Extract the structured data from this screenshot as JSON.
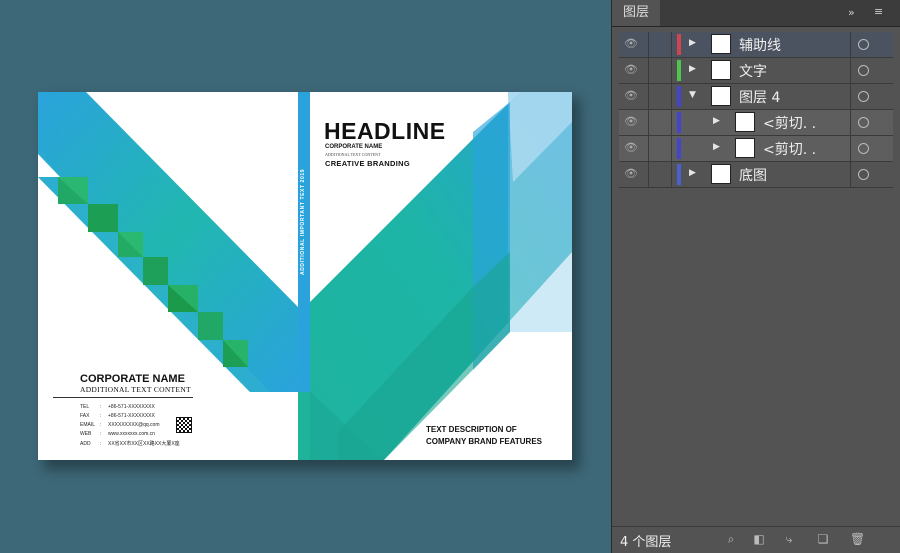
{
  "cover": {
    "headline": "HEADLINE",
    "corporate_name_small": "CORPORATE NAME",
    "additional_text_small": "ADDITIONAL TEXT CONTENT",
    "creative_branding": "CREATIVE BRANDING",
    "corporate_name": "CORPORATE NAME",
    "additional_text": "ADDITIONAL TEXT CONTENT",
    "contacts": [
      {
        "label": "TEL",
        "sep": ":",
        "value": "+86-571-XXXXXXXX"
      },
      {
        "label": "FAX",
        "sep": ":",
        "value": "+86-571-XXXXXXXX"
      },
      {
        "label": "EMAIL",
        "sep": ":",
        "value": "XXXXXXXXX@qq.com"
      },
      {
        "label": "WEB",
        "sep": ":",
        "value": "www.xxxxxxx.com.cn"
      },
      {
        "label": "ADD",
        "sep": ":",
        "value": "XX省XX市XX区XX路XX大厦X座"
      }
    ],
    "spine_text": "ADDITIONAL IMPORTANT TEXT 2019",
    "description_line1": "TEXT DESCRIPTION OF",
    "description_line2": "COMPANY BRAND FEATURES",
    "colors": {
      "canvas_bg": "#3d6878",
      "teal": "#1fb5a5",
      "blue": "#2aa3dc",
      "green": "#1a9a4a",
      "light_blue": "#a8d8f0"
    }
  },
  "layers_panel": {
    "tab_title": "图层",
    "collapse_icon": "»",
    "menu_icon": "≡",
    "layers": [
      {
        "name": "辅助线",
        "color": "#d0434f",
        "expanded": false,
        "indent": 0,
        "selected": true
      },
      {
        "name": "文字",
        "color": "#4ec64e",
        "expanded": false,
        "indent": 0,
        "selected": false
      },
      {
        "name": "图层 4",
        "color": "#4444cc",
        "expanded": true,
        "indent": 0,
        "selected": false
      },
      {
        "name": "<剪切. .",
        "color": "#4444cc",
        "expanded": false,
        "indent": 1,
        "selected": false
      },
      {
        "name": "<剪切. .",
        "color": "#4444cc",
        "expanded": false,
        "indent": 1,
        "selected": false
      },
      {
        "name": "底图",
        "color": "#4a5fd0",
        "expanded": false,
        "indent": 0,
        "selected": false
      }
    ],
    "footer": {
      "layer_count": "4 个图层"
    }
  }
}
